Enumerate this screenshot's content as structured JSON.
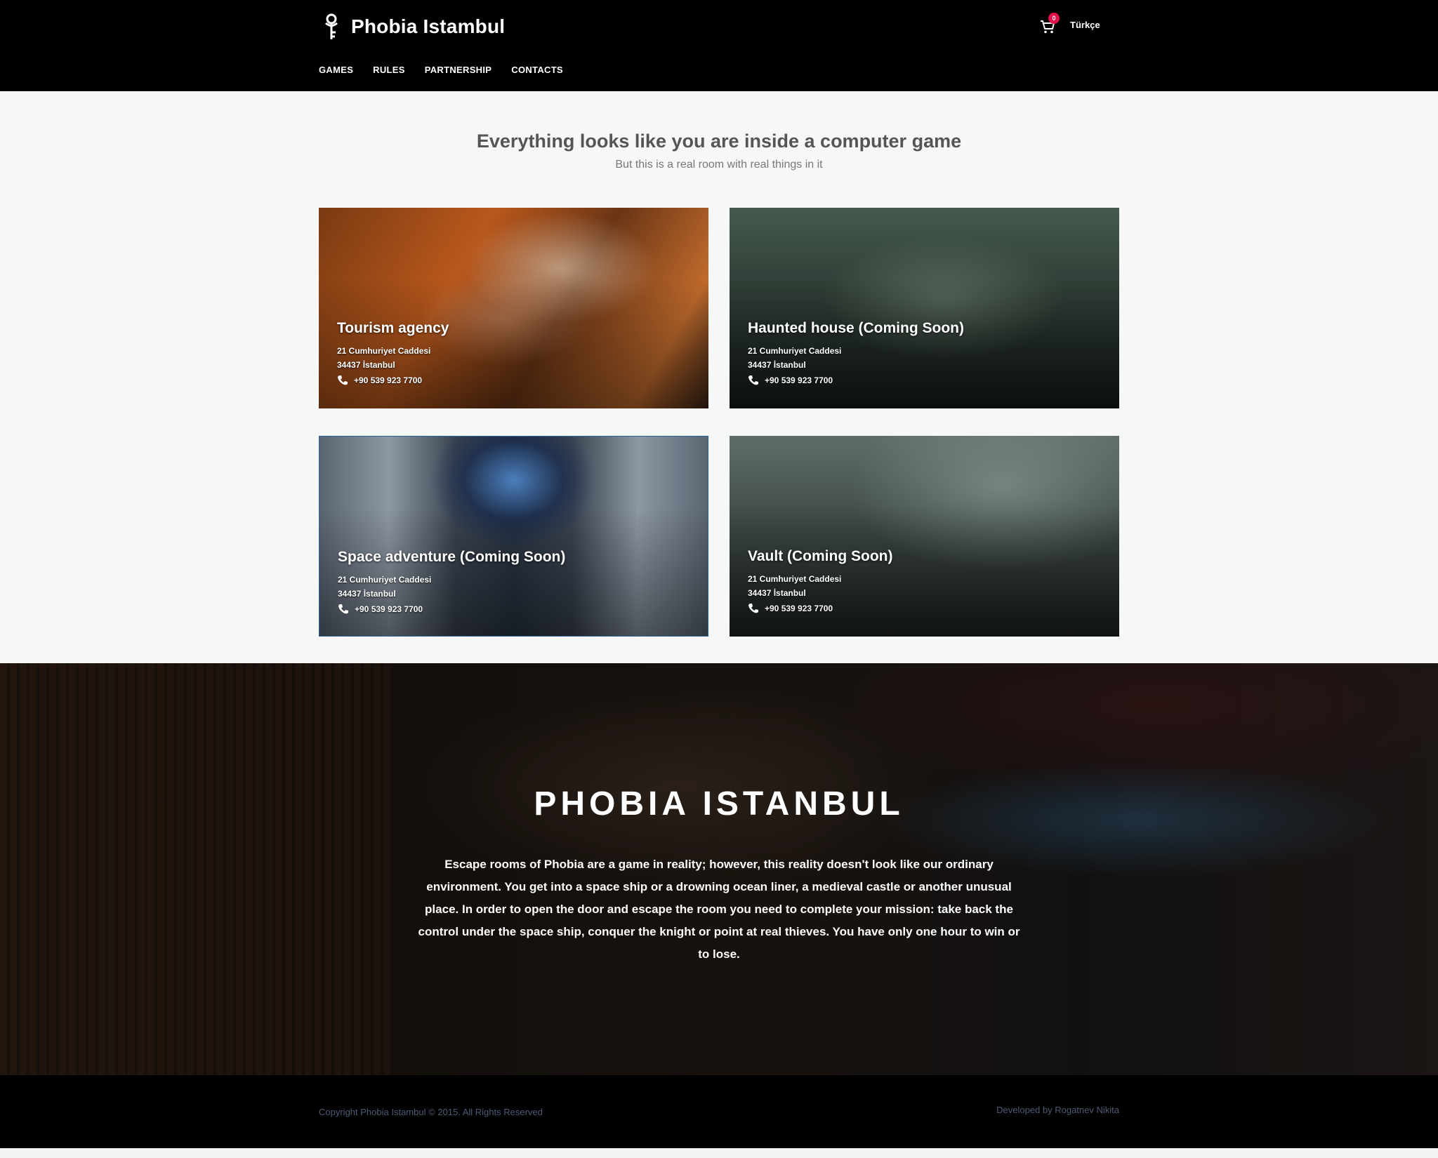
{
  "header": {
    "brand": "Phobia Istambul",
    "nav": [
      "GAMES",
      "RULES",
      "PARTNERSHIP",
      "CONTACTS"
    ],
    "cart_count": "0",
    "language": "Türkçe"
  },
  "intro": {
    "title": "Everything looks like you are inside a computer game",
    "subtitle": "But this is a real room with real things in it"
  },
  "games": [
    {
      "title": "Tourism agency",
      "street": "21 Cumhuriyet Caddesi",
      "city": "34437 İstanbul",
      "phone": "+90 539 923 7700"
    },
    {
      "title": "Haunted house (Coming Soon)",
      "street": "21 Cumhuriyet Caddesi",
      "city": "34437 İstanbul",
      "phone": "+90 539 923 7700"
    },
    {
      "title": "Space adventure (Coming Soon)",
      "street": "21 Cumhuriyet Caddesi",
      "city": "34437 İstanbul",
      "phone": "+90 539 923 7700"
    },
    {
      "title": "Vault (Coming Soon)",
      "street": "21 Cumhuriyet Caddesi",
      "city": "34437 İstanbul",
      "phone": "+90 539 923 7700"
    }
  ],
  "hero": {
    "title": "PHOBIA ISTANBUL",
    "text": "Escape rooms of Phobia are a game in reality; however, this reality doesn't look like our ordinary environment. You get into a space ship or a drowning ocean liner, a medieval castle or another unusual place. In order to open the door and escape the room you need to complete your mission: take back the control under the space ship, conquer the knight or point at real thieves. You have only one hour to win or to lose."
  },
  "footer": {
    "copyright": "Copyright Phobia Istambul © 2015. All Rights Reserved",
    "developer": "Developed by Rogatnev Nikita"
  },
  "colors": {
    "header_bg": "#000000",
    "page_bg": "#f6f7f7",
    "badge": "#e3124b",
    "footer_text": "#4d5a73"
  },
  "icons": {
    "brand": "key-icon",
    "cart": "cart-icon",
    "phone": "phone-icon"
  }
}
